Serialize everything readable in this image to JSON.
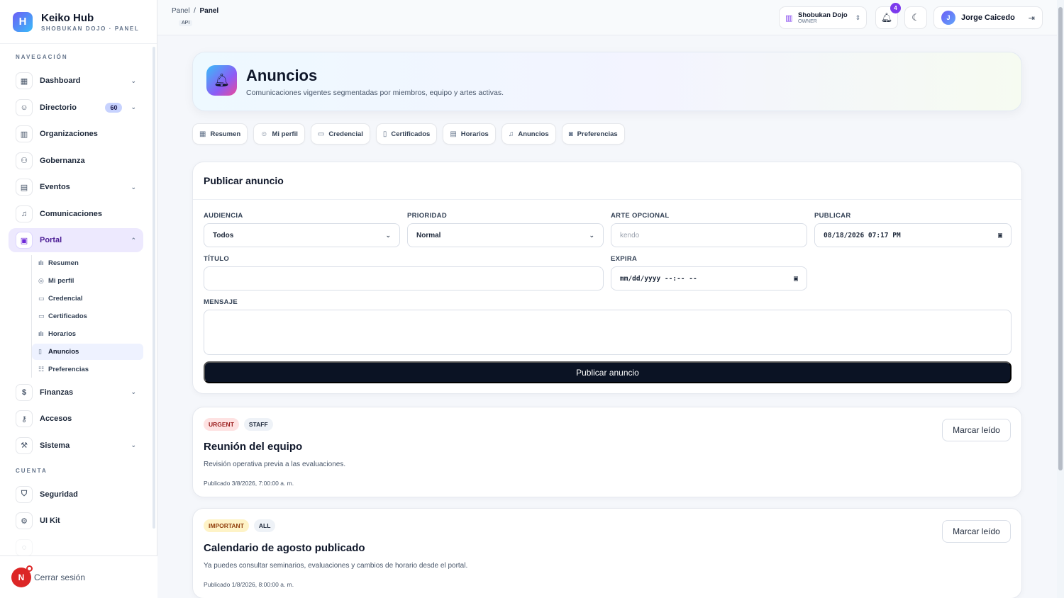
{
  "brand": {
    "title": "Keiko Hub",
    "subtitle": "SHOBUKAN DOJO · PANEL",
    "logo_letter": "H"
  },
  "sidebar": {
    "section_nav": "NAVEGACIÓN",
    "section_account": "CUENTA",
    "items": [
      {
        "label": "Dashboard",
        "icon": "grid-icon",
        "glyph": "▦",
        "chevron": "⌄"
      },
      {
        "label": "Directorio",
        "icon": "users-icon",
        "glyph": "☺",
        "badge": "60",
        "chevron": "⌄"
      },
      {
        "label": "Organizaciones",
        "icon": "building-icon",
        "glyph": "▥"
      },
      {
        "label": "Gobernanza",
        "icon": "hierarchy-icon",
        "glyph": "⚇"
      },
      {
        "label": "Eventos",
        "icon": "calendar-icon",
        "glyph": "▤",
        "chevron": "⌄"
      },
      {
        "label": "Comunicaciones",
        "icon": "bell-icon",
        "glyph": "♫"
      },
      {
        "label": "Portal",
        "icon": "id-card-icon",
        "glyph": "▣",
        "chevron": "⌃"
      }
    ],
    "portal_sub": [
      {
        "label": "Resumen",
        "glyph": "ılı"
      },
      {
        "label": "Mi perfil",
        "glyph": "◎"
      },
      {
        "label": "Credencial",
        "glyph": "▭"
      },
      {
        "label": "Certificados",
        "glyph": "▭"
      },
      {
        "label": "Horarios",
        "glyph": "ılı"
      },
      {
        "label": "Anuncios",
        "glyph": "▯"
      },
      {
        "label": "Preferencias",
        "glyph": "☷"
      }
    ],
    "items_after": [
      {
        "label": "Finanzas",
        "icon": "dollar-icon",
        "glyph": "$",
        "chevron": "⌄"
      },
      {
        "label": "Accesos",
        "icon": "key-icon",
        "glyph": "⚷"
      },
      {
        "label": "Sistema",
        "icon": "wrench-icon",
        "glyph": "⚒",
        "chevron": "⌄"
      }
    ],
    "account_items": [
      {
        "label": "Seguridad",
        "icon": "shield-icon",
        "glyph": "⛉"
      },
      {
        "label": "UI Kit",
        "icon": "gear-icon",
        "glyph": "⚙"
      }
    ],
    "footer_avatar": "N",
    "footer_label": "Cerrar sesión"
  },
  "topbar": {
    "crumb_1": "Panel",
    "crumb_sep": "/",
    "crumb_2": "Panel",
    "api_tag": "API",
    "org_name": "Shobukan Dojo",
    "org_role": "OWNER",
    "notif_count": "4",
    "user_initial": "J",
    "user_name": "Jorge Caicedo"
  },
  "hero": {
    "title": "Anuncios",
    "subtitle": "Comunicaciones vigentes segmentadas por miembros, equipo y artes activas."
  },
  "tabs": [
    {
      "label": "Resumen",
      "glyph": "▦"
    },
    {
      "label": "Mi perfil",
      "glyph": "☺"
    },
    {
      "label": "Credencial",
      "glyph": "▭"
    },
    {
      "label": "Certificados",
      "glyph": "▯"
    },
    {
      "label": "Horarios",
      "glyph": "▤"
    },
    {
      "label": "Anuncios",
      "glyph": "♫"
    },
    {
      "label": "Preferencias",
      "glyph": "◙"
    }
  ],
  "form": {
    "title": "Publicar anuncio",
    "audience_label": "AUDIENCIA",
    "audience_value": "Todos",
    "priority_label": "PRIORIDAD",
    "priority_value": "Normal",
    "art_label": "ARTE OPCIONAL",
    "art_placeholder": "kendo",
    "publish_label": "PUBLICAR",
    "publish_value": "08/18/2026 07:17 PM",
    "title_label": "TÍTULO",
    "title_value": "",
    "expire_label": "EXPIRA",
    "expire_value": "mm/dd/yyyy --:-- --",
    "message_label": "MENSAJE",
    "submit_label": "Publicar anuncio"
  },
  "announcements": [
    {
      "tags": [
        {
          "text": "URGENT",
          "kind": "urgent"
        },
        {
          "text": "STAFF",
          "kind": "neutral"
        }
      ],
      "title": "Reunión del equipo",
      "body": "Revisión operativa previa a las evaluaciones.",
      "date": "Publicado 3/8/2026, 7:00:00 a. m.",
      "action": "Marcar leído"
    },
    {
      "tags": [
        {
          "text": "IMPORTANT",
          "kind": "important"
        },
        {
          "text": "ALL",
          "kind": "neutral"
        }
      ],
      "title": "Calendario de agosto publicado",
      "body": "Ya puedes consultar seminarios, evaluaciones y cambios de horario desde el portal.",
      "date": "Publicado 1/8/2026, 8:00:00 a. m.",
      "action": "Marcar leído"
    }
  ],
  "colors": {
    "accent": "#7c3aed",
    "primary_button": "#0b1324",
    "urgent": "#991b1b",
    "important": "#92400e"
  }
}
